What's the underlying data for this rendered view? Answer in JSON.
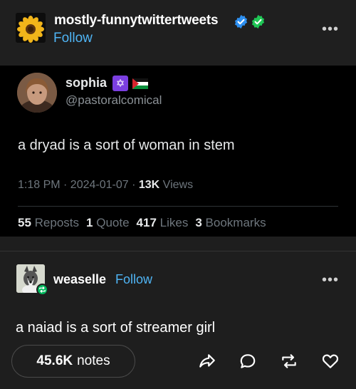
{
  "post": {
    "author": "mostly-funnytwittertweets",
    "follow_label": "Follow",
    "more_label": "•••",
    "icons": [
      "sunflower-avatar",
      "verified-blue-badge",
      "verified-green-badge"
    ]
  },
  "tweet": {
    "name": "sophia",
    "handle": "@pastoralcomical",
    "star_glyph": "✡",
    "text": "a dryad is a sort of woman in stem",
    "time": "1:18 PM · 2024-01-07 · ",
    "views_count": "13K",
    "views_label": " Views",
    "stats": [
      {
        "count": "55",
        "label": "Reposts"
      },
      {
        "count": "1",
        "label": "Quote"
      },
      {
        "count": "417",
        "label": "Likes"
      },
      {
        "count": "3",
        "label": "Bookmarks"
      }
    ]
  },
  "reblog": {
    "author": "weaselle",
    "follow_label": "Follow",
    "more_label": "•••",
    "text": "a naiad is a sort of streamer girl"
  },
  "footer": {
    "notes_count": "45.6K",
    "notes_label": "notes",
    "actions": [
      "share-icon",
      "reply-icon",
      "reblog-icon",
      "like-icon"
    ]
  },
  "colors": {
    "accent": "#4fb4f4",
    "background": "#1e1e1e",
    "tweet_background": "#000000",
    "reblog_green": "#00b85c"
  }
}
